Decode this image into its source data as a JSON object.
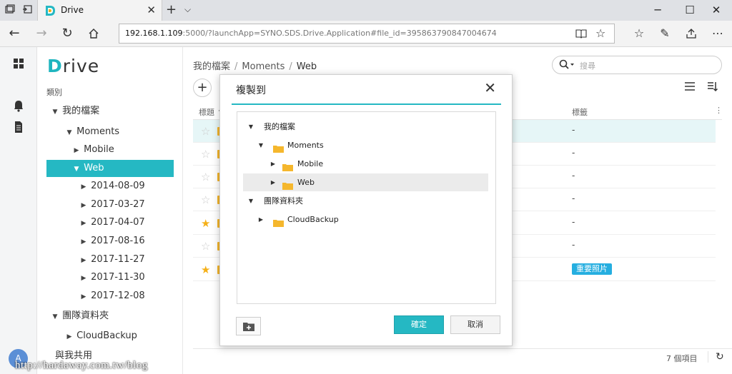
{
  "browser": {
    "tab_title": "Drive",
    "url_host": "192.168.1.109",
    "url_rest": ":5000/?launchApp=SYNO.SDS.Drive.Application#file_id=395863790847004674"
  },
  "app": {
    "brand_d": "D",
    "brand_rest": "rive",
    "category_label": "類別",
    "avatar_letter": "A"
  },
  "sidebar": {
    "items": [
      {
        "label": "我的檔案",
        "arrow": "▼"
      },
      {
        "label": "Moments",
        "arrow": "▼"
      },
      {
        "label": "Mobile",
        "arrow": "▶"
      },
      {
        "label": "Web",
        "arrow": "▼"
      },
      {
        "label": "2014-08-09",
        "arrow": "▶"
      },
      {
        "label": "2017-03-27",
        "arrow": "▶"
      },
      {
        "label": "2017-04-07",
        "arrow": "▶"
      },
      {
        "label": "2017-08-16",
        "arrow": "▶"
      },
      {
        "label": "2017-11-27",
        "arrow": "▶"
      },
      {
        "label": "2017-11-30",
        "arrow": "▶"
      },
      {
        "label": "2017-12-08",
        "arrow": "▶"
      },
      {
        "label": "團隊資料夾",
        "arrow": "▼"
      },
      {
        "label": "CloudBackup",
        "arrow": "▶"
      },
      {
        "label": "與我共用",
        "arrow": ""
      }
    ]
  },
  "main": {
    "breadcrumb": [
      "我的檔案",
      "Moments",
      "Web"
    ],
    "breadcrumb_sep": "/",
    "search_placeholder": "搜尋",
    "add_symbol": "+",
    "columns": {
      "title": "標題",
      "title_sort": "↑",
      "tags": "標籤",
      "more": "⋮"
    },
    "rows": [
      {
        "starred": false,
        "tag": "-",
        "highlight": true
      },
      {
        "starred": false,
        "tag": "-"
      },
      {
        "starred": false,
        "tag": "-"
      },
      {
        "starred": false,
        "tag": "-"
      },
      {
        "starred": true,
        "tag": "-"
      },
      {
        "starred": false,
        "tag": "-"
      },
      {
        "starred": true,
        "tag": "",
        "badge": "重要照片"
      }
    ],
    "item_count": "7 個項目"
  },
  "modal": {
    "title": "複製到",
    "tree": [
      {
        "label": "我的檔案",
        "arrow": "▼",
        "folder": false
      },
      {
        "label": "Moments",
        "arrow": "▼",
        "folder": true
      },
      {
        "label": "Mobile",
        "arrow": "▶",
        "folder": true
      },
      {
        "label": "Web",
        "arrow": "▶",
        "folder": true,
        "selected": true
      },
      {
        "label": "團隊資料夾",
        "arrow": "▼",
        "folder": false
      },
      {
        "label": "CloudBackup",
        "arrow": "▶",
        "folder": true
      }
    ],
    "ok_label": "確定",
    "cancel_label": "取消"
  },
  "watermark": "http://hardaway.com.tw/blog",
  "colors": {
    "accent": "#25b8c3",
    "star": "#f5b018",
    "folder": "#f5b72d",
    "badge": "#25aee0"
  }
}
